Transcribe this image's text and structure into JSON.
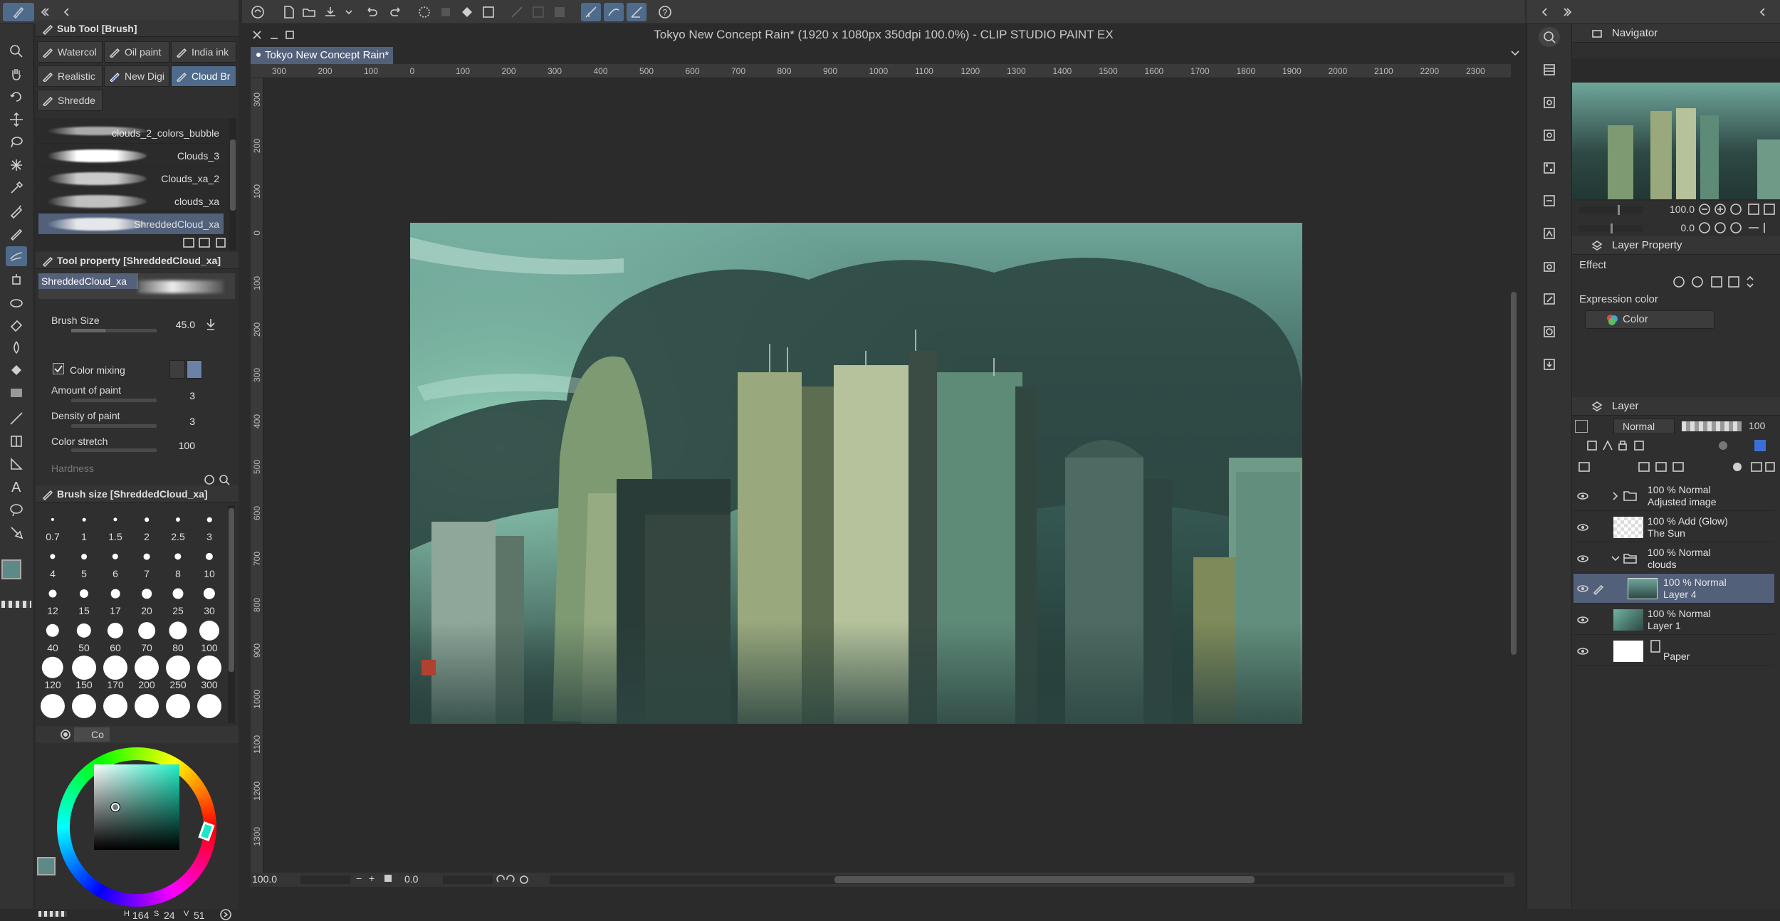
{
  "app": {
    "title": "Tokyo New Concept Rain* (1920 x 1080px 350dpi 100.0%)  - CLIP STUDIO PAINT EX",
    "doc_tab": "Tokyo New Concept Rain*"
  },
  "subtool": {
    "header": "Sub Tool [Brush]",
    "tabs": [
      "Watercol",
      "Oil paint",
      "India ink",
      "Realistic",
      "New Digi",
      "Cloud Br",
      "Shredde"
    ],
    "brushes": [
      "clouds_2_colors_bubble",
      "Clouds_3",
      "Clouds_xa_2",
      "clouds_xa",
      "ShreddedCloud_xa"
    ]
  },
  "toolprop": {
    "header": "Tool property [ShreddedCloud_xa]",
    "preset_name": "ShreddedCloud_xa",
    "brush_size_label": "Brush Size",
    "brush_size": "45.0",
    "color_mixing_label": "Color mixing",
    "amount_label": "Amount of paint",
    "amount": "3",
    "density_label": "Density of paint",
    "density": "3",
    "stretch_label": "Color stretch",
    "stretch": "100",
    "hardness_label": "Hardness"
  },
  "brushsize": {
    "header": "Brush size [ShreddedCloud_xa]",
    "sizes": [
      "0.7",
      "1",
      "1.5",
      "2",
      "2.5",
      "3",
      "4",
      "5",
      "6",
      "7",
      "8",
      "10",
      "12",
      "15",
      "17",
      "20",
      "25",
      "30",
      "40",
      "50",
      "60",
      "70",
      "80",
      "100",
      "120",
      "150",
      "170",
      "200",
      "250",
      "300"
    ]
  },
  "color": {
    "tab_label": "Co",
    "h": "164",
    "s": "24",
    "v": "51",
    "main_color": "#5d8a86",
    "sub_color": "#3a5a55"
  },
  "ruler": {
    "h_labels": [
      "300",
      "200",
      "100",
      "0",
      "100",
      "200",
      "300",
      "400",
      "500",
      "600",
      "700",
      "800",
      "900",
      "1000",
      "1100",
      "1200",
      "1300",
      "1400",
      "1500",
      "1600",
      "1700",
      "1800",
      "1900",
      "2000",
      "2100",
      "2200",
      "2300"
    ],
    "v_labels": [
      "300",
      "200",
      "100",
      "0",
      "100",
      "200",
      "300",
      "400",
      "500",
      "600",
      "700",
      "800",
      "900",
      "1000",
      "1100",
      "1200",
      "1300"
    ]
  },
  "status": {
    "zoom": "100.0",
    "angle": "0.0"
  },
  "navigator": {
    "header": "Navigator",
    "zoom": "100.0",
    "rotation": "0.0"
  },
  "layerprop": {
    "header": "Layer Property",
    "effect_label": "Effect",
    "expr_label": "Expression color",
    "expr_value": "Color"
  },
  "layers": {
    "header": "Layer",
    "blend": "Normal",
    "opacity": "100",
    "rows": [
      {
        "line1": "100 %  Normal",
        "line2": "Adjusted image"
      },
      {
        "line1": "100 %  Add (Glow)",
        "line2": "The Sun"
      },
      {
        "line1": "100 %  Normal",
        "line2": "clouds"
      },
      {
        "line1": "100 %  Normal",
        "line2": "Layer 4"
      },
      {
        "line1": "100 %  Normal",
        "line2": "Layer 1"
      },
      {
        "line1": "",
        "line2": "Paper"
      }
    ]
  }
}
